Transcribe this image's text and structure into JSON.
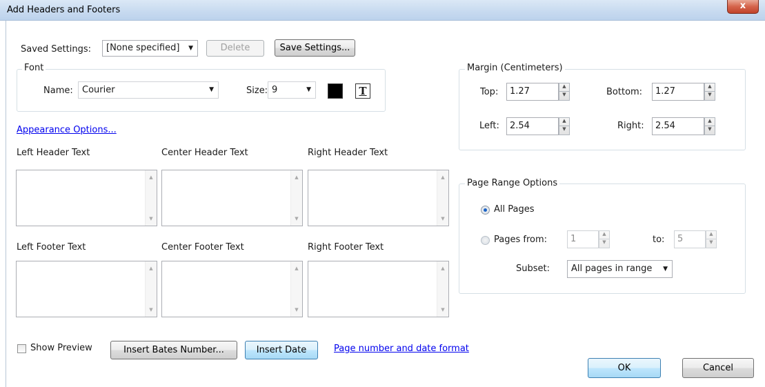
{
  "window": {
    "title": "Add Headers and Footers",
    "close_label": "x"
  },
  "saved_settings": {
    "label": "Saved Settings:",
    "value": "[None specified]",
    "delete_label": "Delete",
    "save_label": "Save Settings..."
  },
  "font": {
    "group_title": "Font",
    "name_label": "Name:",
    "name_value": "Courier",
    "size_label": "Size:",
    "size_value": "9",
    "color": "#000000",
    "text_icon_glyph": "T"
  },
  "appearance_link": "Appearance Options...",
  "header_text": {
    "left": "Left Header Text",
    "center": "Center Header Text",
    "right": "Right Header Text"
  },
  "footer_text": {
    "left": "Left Footer Text",
    "center": "Center Footer Text",
    "right": "Right Footer Text"
  },
  "margin": {
    "group_title": "Margin (Centimeters)",
    "top_label": "Top:",
    "top_value": "1.27",
    "bottom_label": "Bottom:",
    "bottom_value": "1.27",
    "left_label": "Left:",
    "left_value": "2.54",
    "right_label": "Right:",
    "right_value": "2.54"
  },
  "page_range": {
    "group_title": "Page Range Options",
    "all_pages_label": "All Pages",
    "pages_from_label": "Pages from:",
    "from_value": "1",
    "to_label": "to:",
    "to_value": "5",
    "subset_label": "Subset:",
    "subset_value": "All pages in range"
  },
  "bottom_bar": {
    "show_preview_label": "Show Preview",
    "insert_bates_label": "Insert Bates Number...",
    "insert_date_label": "Insert Date",
    "page_number_link": "Page number and date format"
  },
  "dialog_buttons": {
    "ok_label": "OK",
    "cancel_label": "Cancel"
  },
  "icons": {
    "dropdown_arrow": "chevron-down-icon",
    "spin_up": "triangle-up-icon",
    "spin_down": "triangle-down-icon"
  }
}
